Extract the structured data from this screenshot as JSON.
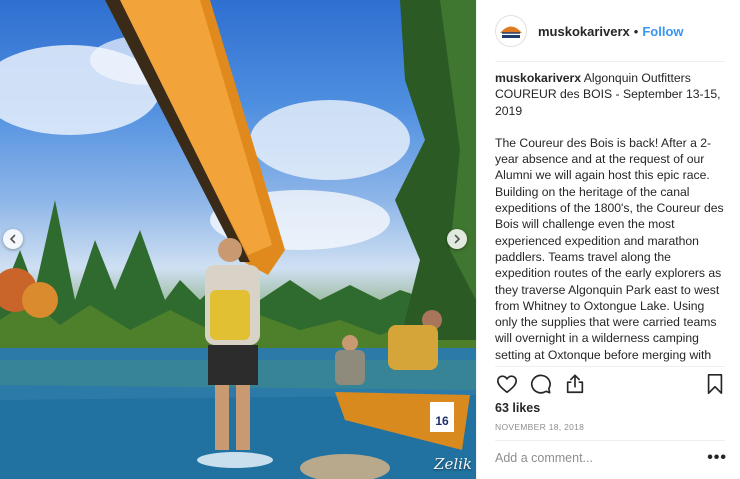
{
  "post": {
    "username": "muskokariverx",
    "follow_label": "Follow",
    "separator": "•",
    "avatar_label": "MUSKOKA RIVER X",
    "caption_username": "muskokariverx",
    "caption_title": "Algonquin Outfitters COUREUR des BOIS - September 13-15, 2019",
    "caption_body": "The Coureur des Bois is back! After a 2-year absence and at the request of our Alumni we will again host this epic race. Building on the heritage of the canal expeditions of the 1800's, the Coureur des Bois will challenge even the most experienced expedition and marathon paddlers. Teams travel along the expedition routes of the early explorers as they traverse Algonquin Park east to west from Whitney to Oxtongue Lake. Using only the supplies that were carried teams will overnight in a wilderness camping setting at Oxtonque before merging with the Muskoka River X Classic B-Side for a second full day of paddle racing. 223km. 36 portages. 48 hours or less. No resupplies. No support. No bs. Just the wilderness and you.",
    "likes": "63 likes",
    "date": "NOVEMBER 18, 2018",
    "comment_placeholder": "Add a comment...",
    "more_label": "•••"
  },
  "photo": {
    "credit": "Zelik",
    "bib_number": "16"
  },
  "icons": {
    "like": "heart-icon",
    "comment": "speech-bubble-icon",
    "share": "share-icon",
    "save": "bookmark-icon",
    "prev": "chevron-left-icon",
    "next": "chevron-right-icon"
  },
  "colors": {
    "link": "#3897f0",
    "text": "#262626",
    "muted": "#8e8e8e",
    "canoe": "#e08a1e"
  }
}
